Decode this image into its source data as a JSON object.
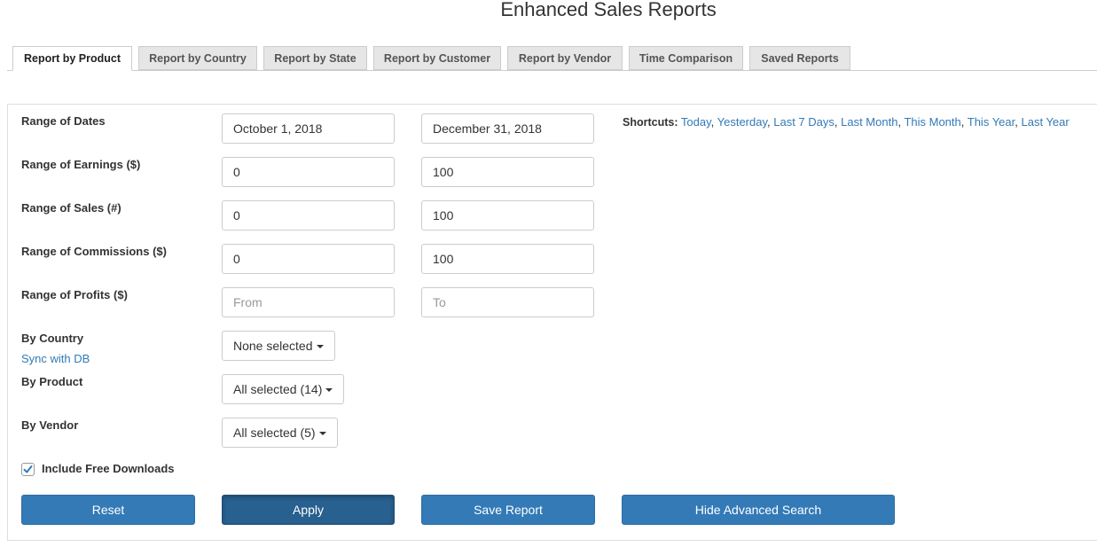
{
  "title": "Enhanced Sales Reports",
  "tabs": [
    {
      "label": "Report by Product",
      "active": true
    },
    {
      "label": "Report by Country",
      "active": false
    },
    {
      "label": "Report by State",
      "active": false
    },
    {
      "label": "Report by Customer",
      "active": false
    },
    {
      "label": "Report by Vendor",
      "active": false
    },
    {
      "label": "Time Comparison",
      "active": false
    },
    {
      "label": "Saved Reports",
      "active": false
    }
  ],
  "form": {
    "dates": {
      "label": "Range of Dates",
      "from": "October 1, 2018",
      "to": "December 31, 2018"
    },
    "earnings": {
      "label": "Range of Earnings ($)",
      "from": "0",
      "to": "100"
    },
    "sales": {
      "label": "Range of Sales (#)",
      "from": "0",
      "to": "100"
    },
    "commissions": {
      "label": "Range of Commissions ($)",
      "from": "0",
      "to": "100"
    },
    "profits": {
      "label": "Range of Profits ($)",
      "from": "",
      "to": "",
      "from_placeholder": "From",
      "to_placeholder": "To"
    },
    "country": {
      "label": "By Country",
      "value": "None selected",
      "sync_link": "Sync with DB"
    },
    "product": {
      "label": "By Product",
      "value": "All selected (14)"
    },
    "vendor": {
      "label": "By Vendor",
      "value": "All selected (5)"
    },
    "free_downloads": {
      "label": "Include Free Downloads",
      "checked": true
    }
  },
  "shortcuts": {
    "label": "Shortcuts:",
    "links": [
      "Today",
      "Yesterday",
      "Last 7 Days",
      "Last Month",
      "This Month",
      "This Year",
      "Last Year"
    ]
  },
  "buttons": {
    "reset": "Reset",
    "apply": "Apply",
    "save": "Save Report",
    "hide_advanced": "Hide Advanced Search"
  },
  "colors": {
    "primary": "#337ab7",
    "primary_pressed": "#286090",
    "link": "#337ab7"
  }
}
